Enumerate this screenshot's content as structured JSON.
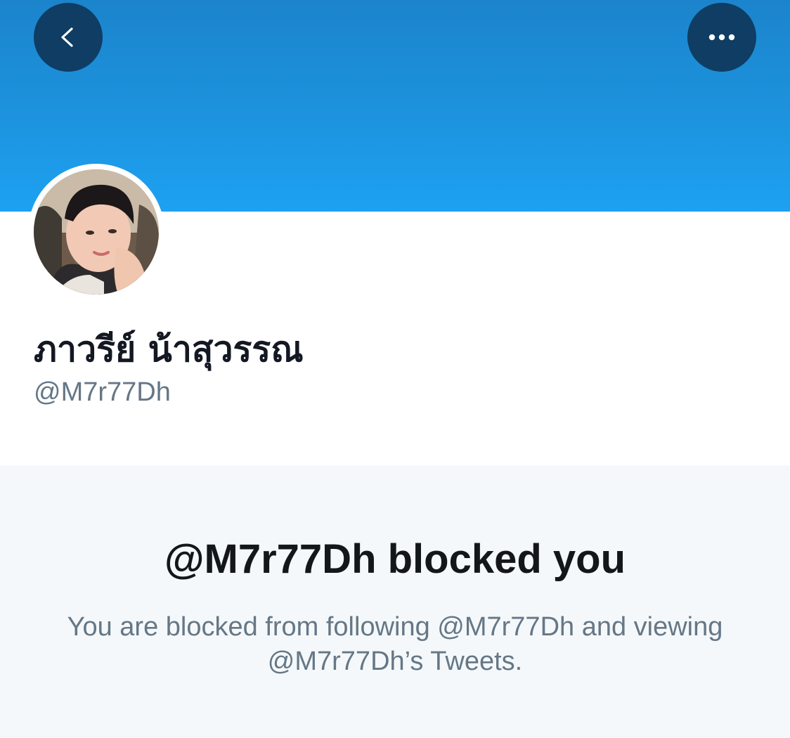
{
  "header": {
    "back_icon": "chevron-left-icon",
    "more_icon": "ellipsis-horizontal-icon",
    "banner_color": "#1da1f2",
    "button_color": "#0f3d63"
  },
  "profile": {
    "display_name": "ภาวรีย์ น้าสุวรรณ",
    "handle": "@M7r77Dh"
  },
  "blocked": {
    "title": "@M7r77Dh blocked you",
    "description": "You are blocked from following @M7r77Dh and viewing @M7r77Dh’s Tweets."
  },
  "colors": {
    "name_text": "#141823",
    "secondary_text": "#657786",
    "panel_background": "#f5f8fa"
  }
}
